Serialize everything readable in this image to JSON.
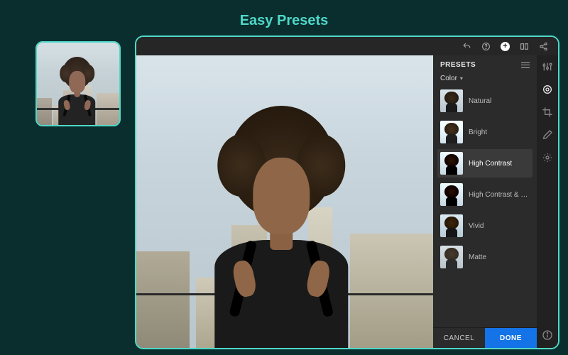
{
  "title": "Easy Presets",
  "toolbar": {
    "icons": [
      "undo",
      "help",
      "add",
      "compare",
      "share"
    ]
  },
  "panel": {
    "header": "PRESETS",
    "category": "Color",
    "presets": [
      {
        "label": "Natural",
        "selected": false
      },
      {
        "label": "Bright",
        "selected": false
      },
      {
        "label": "High Contrast",
        "selected": true
      },
      {
        "label": "High Contrast & Detail",
        "selected": false
      },
      {
        "label": "Vivid",
        "selected": false
      },
      {
        "label": "Matte",
        "selected": false
      }
    ],
    "cancel_label": "CANCEL",
    "done_label": "DONE"
  },
  "rail": {
    "tools": [
      "edit-sliders",
      "presets-circle",
      "crop",
      "brush",
      "radial"
    ],
    "active_index": 1,
    "info": "info"
  },
  "colors": {
    "accent": "#4fd8c8",
    "primary_button": "#1473e6"
  }
}
